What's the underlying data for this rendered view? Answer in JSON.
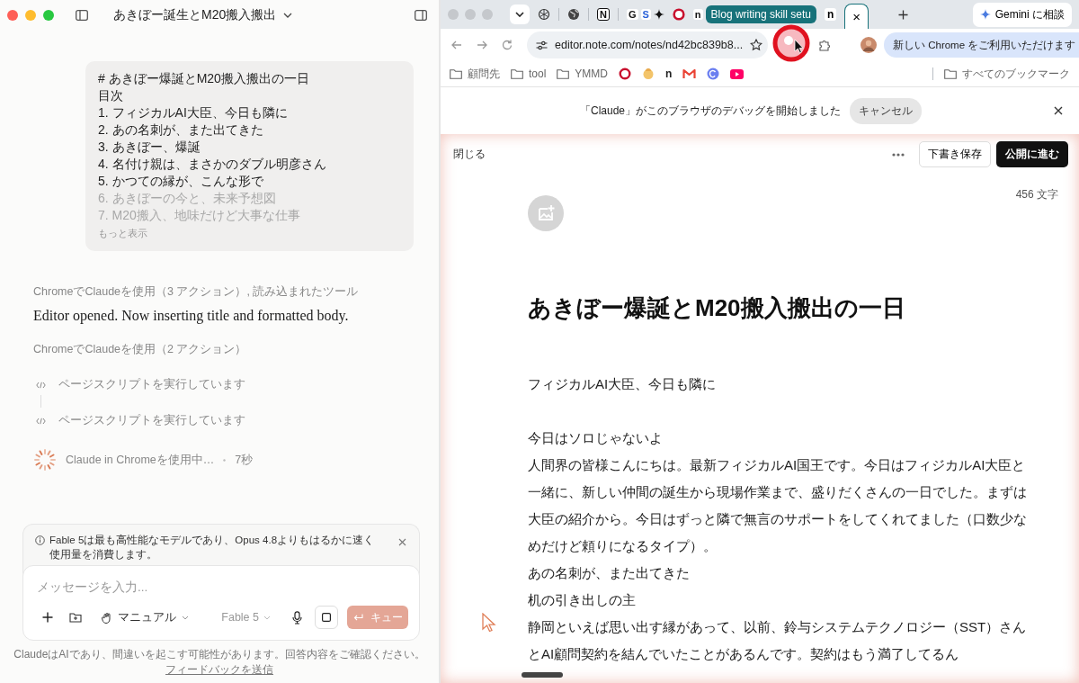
{
  "chat": {
    "title": "あきぼー誕生とM20搬入搬出",
    "message": {
      "lines": [
        "# あきぼー爆誕とM20搬入搬出の一日",
        "目次",
        "1. フィジカルAI大臣、今日も隣に",
        "2. あの名刺が、また出てきた",
        "3. あきぼー、爆誕",
        "4. 名付け親は、まさかのダブル明彦さん",
        "5. かつての縁が、こんな形で",
        "6. あきぼーの今と、未来予想図",
        "7. M20搬入、地味だけど大事な仕事"
      ],
      "more": "もっと表示"
    },
    "activity": [
      {
        "kind": "label",
        "text": "ChromeでClaudeを使用（3 アクション）, 読み込まれたツール"
      },
      {
        "kind": "reply",
        "text": "Editor opened. Now inserting title and formatted body."
      },
      {
        "kind": "label",
        "text": "ChromeでClaudeを使用（2 アクション）"
      },
      {
        "kind": "step",
        "text": "ページスクリプトを実行しています"
      },
      {
        "kind": "step",
        "text": "ページスクリプトを実行しています"
      },
      {
        "kind": "status",
        "text": "Claude in Chromeを使用中…",
        "time": "7秒"
      }
    ],
    "notice": "Fable 5は最も高性能なモデルであり、Opus 4.8よりもはるかに速く使用量を消費します。",
    "composer": {
      "placeholder": "メッセージを入力...",
      "mode": "マニュアル",
      "model": "Fable 5",
      "queue_button": "キュー"
    },
    "disclaimer": "ClaudeはAIであり、間違いを起こす可能性があります。回答内容をご確認ください。",
    "feedback_link": "フィードバックを送信"
  },
  "browser": {
    "pinned": [
      {
        "kind": "knot"
      },
      {
        "kind": "globe"
      },
      {
        "kind": "letter",
        "text": "N"
      },
      {
        "kind": "letter",
        "text": "G"
      },
      {
        "kind": "letter",
        "text": "S"
      },
      {
        "kind": "spark"
      },
      {
        "kind": "ring"
      },
      {
        "kind": "letter",
        "text": "n"
      }
    ],
    "tab_group": "Blog writing skill setu",
    "tabs": [
      {
        "text": "n",
        "selected": false
      },
      {
        "text": "×",
        "selected": true
      }
    ],
    "gemini_button": "Gemini に相談",
    "url": "editor.note.com/notes/nd42bc839b8...",
    "chrome_promo": "新しい Chrome をご利用いただけます",
    "bookmarks": [
      {
        "kind": "folder",
        "label": "顧問先"
      },
      {
        "kind": "folder",
        "label": "tool"
      },
      {
        "kind": "folder",
        "label": "YMMD"
      },
      {
        "kind": "ring"
      },
      {
        "kind": "face"
      },
      {
        "kind": "letter",
        "label": "n"
      },
      {
        "kind": "mail"
      },
      {
        "kind": "swirl"
      },
      {
        "kind": "play"
      }
    ],
    "all_bookmarks": "すべてのブックマーク",
    "debug_banner": {
      "text": "「Claude」がこのブラウザのデバッグを開始しました",
      "cancel": "キャンセル"
    }
  },
  "editor": {
    "close": "閉じる",
    "save": "下書き保存",
    "publish": "公開に進む",
    "count": "456 文字",
    "title": "あきぼー爆誕とM20搬入搬出の一日",
    "sections": [
      [
        "フィジカルAI大臣、今日も隣に"
      ],
      [
        "今日はソロじゃないよ",
        "人間界の皆様こんにちは。最新フィジカルAI国王です。今日はフィジカルAI大臣と一緒に、新しい仲間の誕生から現場作業まで、盛りだくさんの一日でした。まずは大臣の紹介から。今日はずっと隣で無言のサポートをしてくれてました（口数少なめだけど頼りになるタイプ）。",
        "あの名刺が、また出てきた",
        "机の引き出しの主",
        "静岡といえば思い出す縁があって、以前、鈴与システムテクノロジー（SST）さんとAI顧問契約を結んでいたことがあるんです。契約はもう満了してるん"
      ]
    ]
  }
}
